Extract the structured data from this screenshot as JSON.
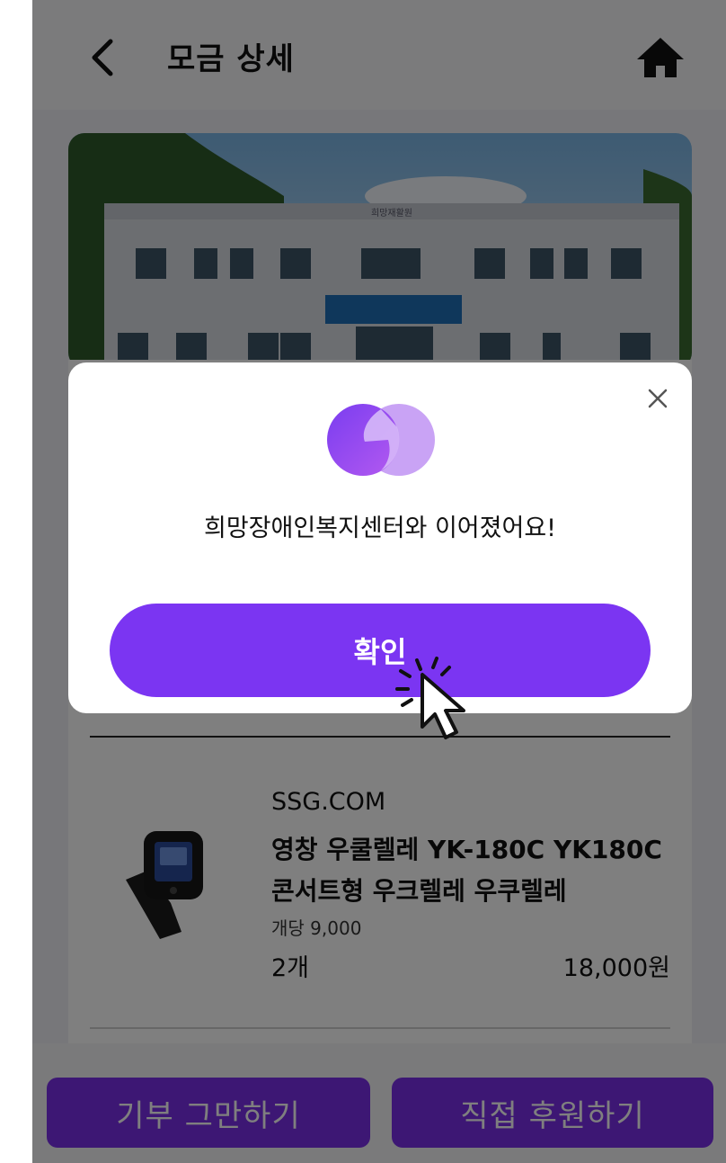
{
  "header": {
    "back_icon": "chevron-left-icon",
    "title": "모금 상세",
    "home_icon": "home-icon"
  },
  "hero": {
    "building_sign": "희망재활원"
  },
  "product": {
    "store": "SSG.COM",
    "name": "영창 우쿨렐레 YK-180C YK180C 콘서트형 우크렐레 우쿠렐레",
    "unit_price": "개당 9,000",
    "quantity": "2개",
    "total": "18,000원",
    "thumb_icon": "clip-tuner-image"
  },
  "footer": {
    "stop_label": "기부 그만하기",
    "direct_label": "직접 후원하기"
  },
  "modal": {
    "close_icon": "close-icon",
    "logo_icon": "linked-circles-logo",
    "message": "희망장애인복지센터와 이어졌어요!",
    "confirm_label": "확인"
  },
  "colors": {
    "accent": "#7b35f2",
    "accent_dark": "#7a2ee8",
    "overlay": "rgba(0,0,0,0.5)"
  }
}
